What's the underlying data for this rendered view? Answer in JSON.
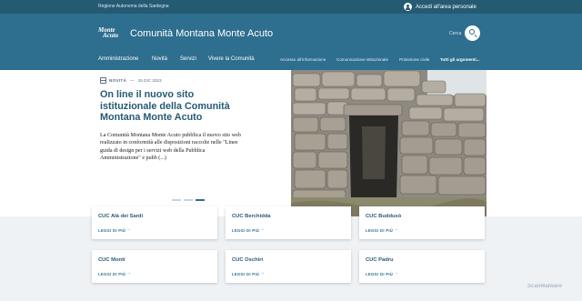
{
  "topbar": {
    "region": "Regione Autonoma della Sardegna",
    "login_label": "Accedi all'area personale"
  },
  "header": {
    "logo_line1": "Monte",
    "logo_line2": "Acuto",
    "title": "Comunità Montana Monte Acuto",
    "search_label": "Cerca"
  },
  "nav": {
    "main": [
      "Amministrazione",
      "Novità",
      "Servizi",
      "Vivere la Comunità"
    ],
    "secondary": [
      "Accesso all'informazione",
      "Comunicazione istituzionale",
      "Protezione civile"
    ],
    "all_topics": "Tutti gli argomenti..."
  },
  "hero": {
    "category": "NOVITÀ",
    "dash": "—",
    "date": "15 DIC 2023",
    "headline": "On line il nuovo sito istituzionale della Comunità Montana Monte Acuto",
    "excerpt": "La Comunità Montana Monte Acuto pubblica il nuovo sito web realizzato in conformità alle disposizioni raccolte nelle \"Linee guida di design per i servizi web della Pubblica Amministrazione\" e pubb (...)",
    "slides": 3,
    "active_slide": 3
  },
  "cards": [
    {
      "title": "CUC Alà dei Sardi",
      "link": "LEGGI DI PIÙ"
    },
    {
      "title": "CUC Berchidda",
      "link": "LEGGI DI PIÙ"
    },
    {
      "title": "CUC Buddusò",
      "link": "LEGGI DI PIÙ"
    },
    {
      "title": "CUC Monti",
      "link": "LEGGI DI PIÙ"
    },
    {
      "title": "CUC Oschiri",
      "link": "LEGGI DI PIÙ"
    },
    {
      "title": "CUC Padru",
      "link": "LEGGI DI PIÙ"
    }
  ],
  "watermark": "ScanMalware",
  "colors": {
    "primary": "#2e6e8e",
    "primary_dark": "#255a73",
    "cards_background": "#eef2f5"
  }
}
